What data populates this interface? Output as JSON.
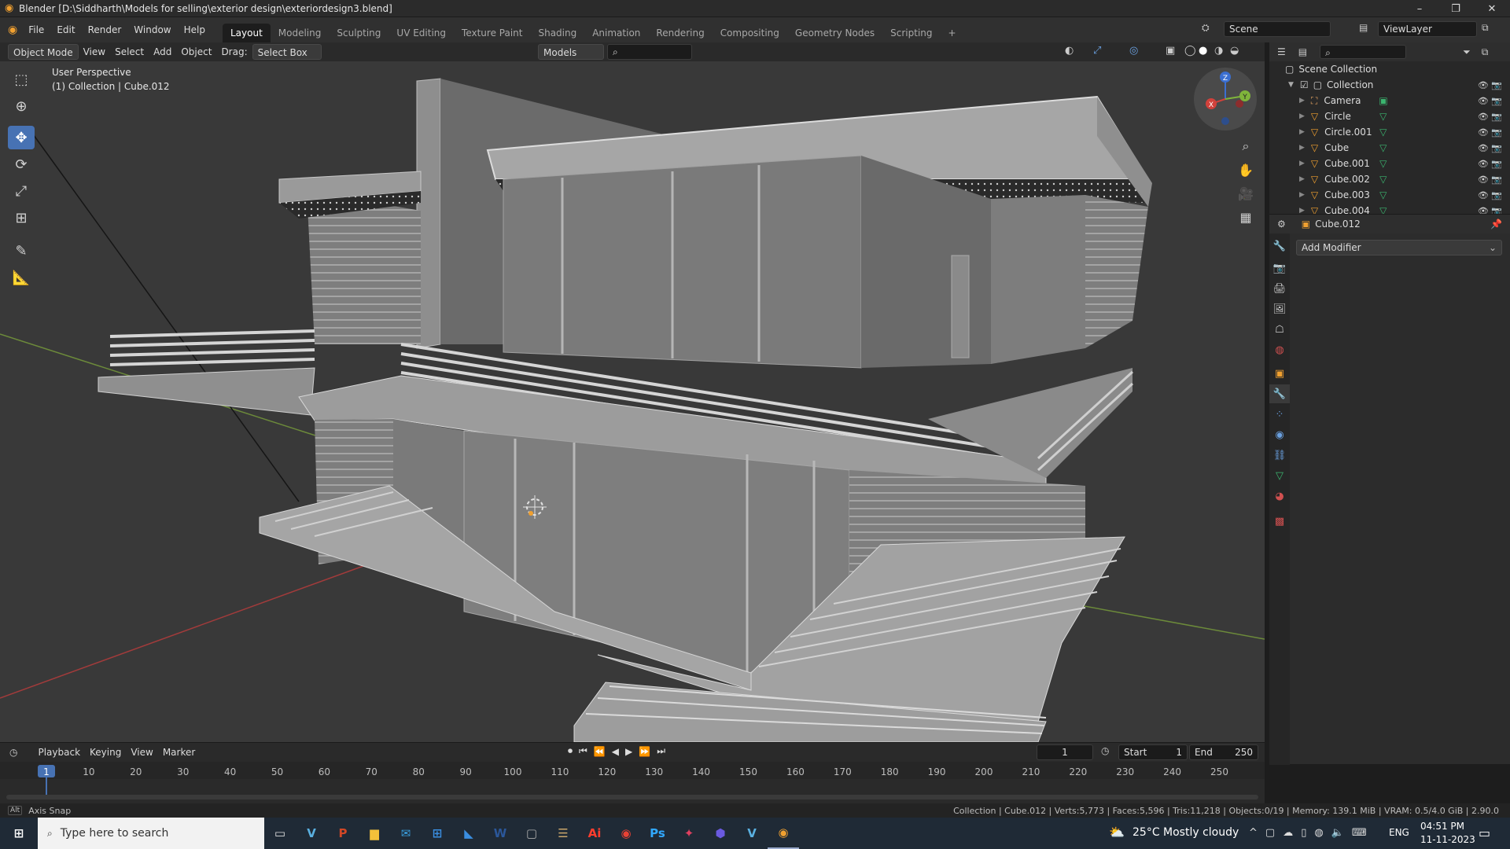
{
  "window": {
    "title": "Blender [D:\\Siddharth\\Models for selling\\exterior design\\exteriordesign3.blend]",
    "controls": [
      "–",
      "❐",
      "✕"
    ]
  },
  "menubar": {
    "menus": [
      "File",
      "Edit",
      "Render",
      "Window",
      "Help"
    ],
    "workspaces": [
      "Layout",
      "Modeling",
      "Sculpting",
      "UV Editing",
      "Texture Paint",
      "Shading",
      "Animation",
      "Rendering",
      "Compositing",
      "Geometry Nodes",
      "Scripting",
      "+"
    ],
    "active_workspace": "Layout",
    "scene_label": "Scene",
    "viewlayer_label": "ViewLayer"
  },
  "viewport_header": {
    "mode": "Object Mode",
    "view": "View",
    "select": "Select",
    "add": "Add",
    "object": "Object",
    "drag_label": "Drag:",
    "drag_value": "Select Box",
    "orientation": "Models",
    "search_placeholder": ""
  },
  "viewport": {
    "perspective": "User Perspective",
    "collection_info": "(1) Collection | Cube.012",
    "gizmo_axes": [
      "X",
      "Y",
      "Z"
    ]
  },
  "toolbar": {
    "tools": [
      {
        "name": "select-box-tool",
        "glyph": "⬚",
        "active": false
      },
      {
        "name": "cursor-tool",
        "glyph": "⊕",
        "active": false
      },
      {
        "name": "move-tool",
        "glyph": "✥",
        "active": true
      },
      {
        "name": "rotate-tool",
        "glyph": "⟳",
        "active": false
      },
      {
        "name": "scale-tool",
        "glyph": "⤢",
        "active": false
      },
      {
        "name": "transform-tool",
        "glyph": "⊞",
        "active": false
      },
      {
        "name": "annotate-tool",
        "glyph": "✎",
        "active": false
      },
      {
        "name": "measure-tool",
        "glyph": "📐",
        "active": false
      }
    ]
  },
  "outliner": {
    "root": "Scene Collection",
    "collection": "Collection",
    "items": [
      {
        "name": "Camera",
        "type": "camera"
      },
      {
        "name": "Circle",
        "type": "mesh"
      },
      {
        "name": "Circle.001",
        "type": "mesh"
      },
      {
        "name": "Cube",
        "type": "mesh"
      },
      {
        "name": "Cube.001",
        "type": "mesh"
      },
      {
        "name": "Cube.002",
        "type": "mesh"
      },
      {
        "name": "Cube.003",
        "type": "mesh"
      },
      {
        "name": "Cube.004",
        "type": "mesh"
      }
    ]
  },
  "properties": {
    "object_name": "Cube.012",
    "add_modifier": "Add Modifier"
  },
  "timeline": {
    "playback": "Playback",
    "keying": "Keying",
    "view": "View",
    "marker": "Marker",
    "current_frame": "1",
    "start_label": "Start",
    "start": "1",
    "end_label": "End",
    "end": "250",
    "ticks": [
      "1",
      "10",
      "20",
      "30",
      "40",
      "50",
      "60",
      "70",
      "80",
      "90",
      "100",
      "110",
      "120",
      "130",
      "140",
      "150",
      "160",
      "170",
      "180",
      "190",
      "200",
      "210",
      "220",
      "230",
      "240",
      "250"
    ]
  },
  "statusbar": {
    "left_key": "Alt",
    "left": "Axis Snap",
    "right": "Collection | Cube.012 | Verts:5,773 | Faces:5,596 | Tris:11,218 | Objects:0/19 | Memory: 139.1 MiB | VRAM: 0.5/4.0 GiB | 2.90.0"
  },
  "taskbar": {
    "search_placeholder": "Type here to search",
    "weather": "25°C  Mostly cloudy",
    "lang": "ENG",
    "time": "04:51 PM",
    "date": "11-11-2023"
  }
}
